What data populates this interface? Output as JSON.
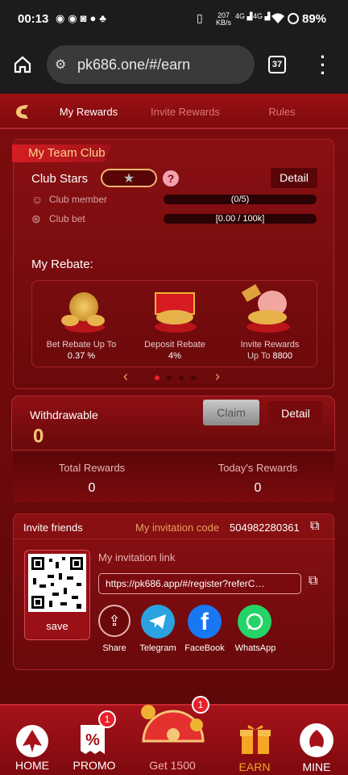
{
  "status": {
    "time": "00:13",
    "net_speed": "207",
    "net_unit": "KB/s",
    "signal1": "4G",
    "signal2": "4G",
    "battery": "89%"
  },
  "browser": {
    "url": "pk686.one/#/earn",
    "tab_count": "37"
  },
  "tabs": [
    {
      "label": "My Rewards"
    },
    {
      "label": "Invite Rewards"
    },
    {
      "label": "Rules"
    }
  ],
  "team_club": {
    "title": "My Team Club",
    "stars_label": "Club Stars",
    "detail": "Detail",
    "member_label": "Club member",
    "member_value": "(0/5)",
    "bet_label": "Club bet",
    "bet_value": "[0.00 / 100k]"
  },
  "rebate": {
    "title": "My Rebate:",
    "items": [
      {
        "line1": "Bet Rebate Up To",
        "line2": "0.37 %"
      },
      {
        "line1": "Deposit Rebate",
        "line2": "4%"
      },
      {
        "line1": "Invite Rewards",
        "line2a": "Up To ",
        "line2b": "8800"
      }
    ]
  },
  "withdraw": {
    "label": "Withdrawable",
    "amount": "0",
    "claim": "Claim",
    "detail": "Detail"
  },
  "totals": {
    "total_label": "Total Rewards",
    "total_value": "0",
    "today_label": "Today's Rewards",
    "today_value": "0"
  },
  "invite": {
    "title": "Invite friends",
    "code_label": "My invitation code",
    "code": "504982280361",
    "link_label": "My invitation link",
    "link": "https://pk686.app/#/register?referC…",
    "save": "save",
    "share": [
      {
        "label": "Share"
      },
      {
        "label": "Telegram"
      },
      {
        "label": "FaceBook"
      },
      {
        "label": "WhatsApp"
      }
    ]
  },
  "bottom_nav": {
    "items": [
      {
        "label": "HOME"
      },
      {
        "label": "PROMO",
        "badge": "1"
      },
      {
        "label": "Get 1500",
        "badge": "1"
      },
      {
        "label": "EARN"
      },
      {
        "label": "MINE"
      }
    ]
  },
  "colors": {
    "accent": "#f4c676",
    "bg": "#7e0c0f",
    "active_nav": "#f5a623"
  }
}
